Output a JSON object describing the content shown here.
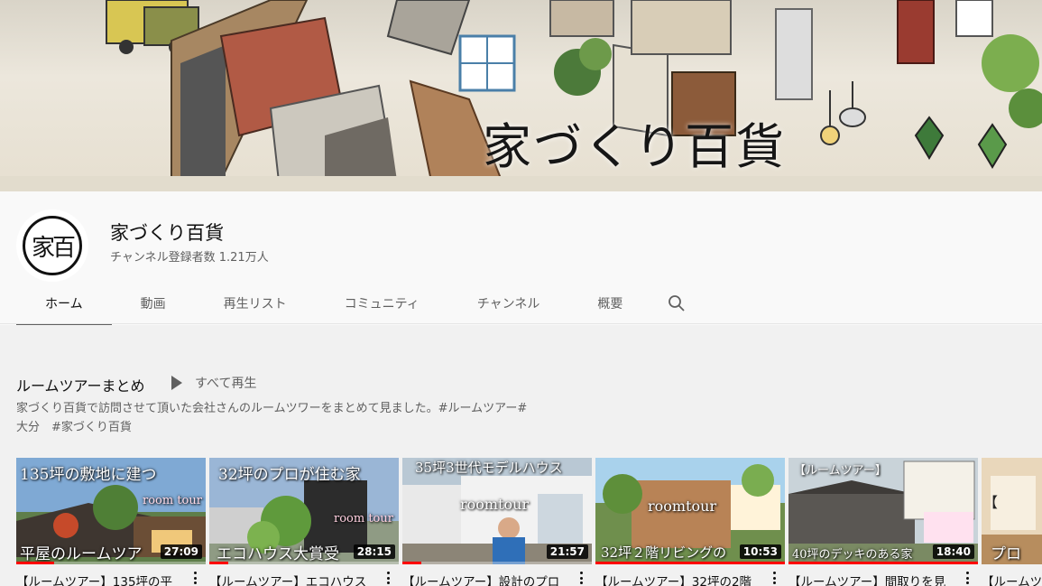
{
  "banner": {
    "title": "家づくり百貨"
  },
  "channel": {
    "name": "家づくり百貨",
    "subscribers": "チャンネル登録者数 1.21万人",
    "avatar_text": "家百"
  },
  "tabs": [
    {
      "label": "ホーム",
      "active": true
    },
    {
      "label": "動画",
      "active": false
    },
    {
      "label": "再生リスト",
      "active": false
    },
    {
      "label": "コミュニティ",
      "active": false
    },
    {
      "label": "チャンネル",
      "active": false
    },
    {
      "label": "概要",
      "active": false
    }
  ],
  "search_icon": "search-icon",
  "section": {
    "title": "ルームツアーまとめ",
    "play_all": "すべて再生",
    "description_line1": "家づくり百貨で訪問させて頂いた会社さんのルームツワーをまとめて見ました。#ルームツアー#",
    "description_line2": "大分　#家づくり百貨"
  },
  "videos": [
    {
      "thumb_top": "135坪の敷地に建つ",
      "thumb_tag": "room tour",
      "thumb_bottom": "平屋のルームツア",
      "duration": "27:09",
      "title": "【ルームツアー】135坪の平",
      "progress": 0.2
    },
    {
      "thumb_top": "32坪のプロが住む家",
      "thumb_tag": "room tour",
      "thumb_bottom": "エコハウス大賞受",
      "duration": "28:15",
      "title": "【ルームツアー】エコハウス",
      "progress": 0.1
    },
    {
      "thumb_top": "35坪3世代モデルハウス",
      "thumb_tag": "roomtour",
      "thumb_bottom": "",
      "duration": "21:57",
      "title": "【ルームツアー】設計のプロ",
      "progress": 0.1
    },
    {
      "thumb_top": "",
      "thumb_tag": "roomtour",
      "thumb_bottom": "32坪２階リビングの",
      "duration": "10:53",
      "title": "【ルームツアー】32坪の2階",
      "progress": 1.0
    },
    {
      "thumb_top": "【ルームツアー】",
      "thumb_tag": "",
      "thumb_bottom": "40坪のデッキのある家",
      "duration": "18:40",
      "title": "【ルームツアー】間取りを見",
      "progress": 1.0
    },
    {
      "thumb_top": "【",
      "thumb_tag": "",
      "thumb_bottom": "プロ",
      "duration": "",
      "title": "【ルームツ",
      "progress": 0.0
    }
  ]
}
